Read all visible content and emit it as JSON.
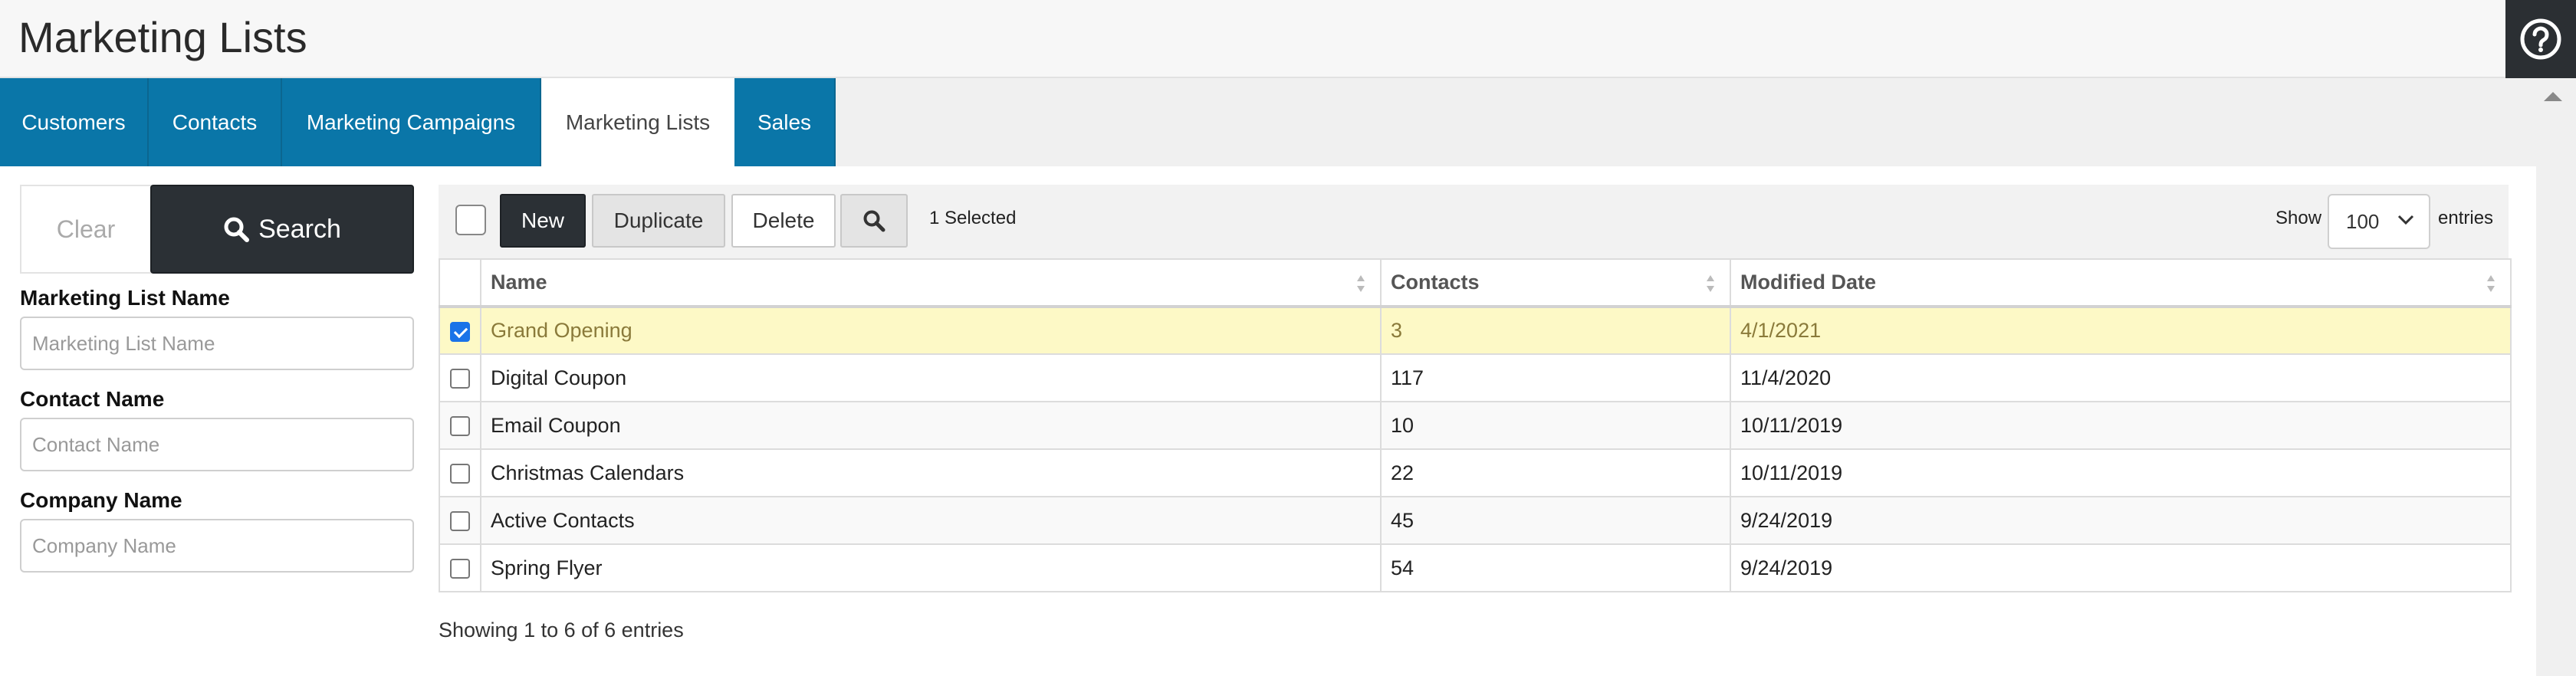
{
  "header": {
    "title": "Marketing Lists",
    "help_icon": "question-circle-icon"
  },
  "tabs": [
    {
      "label": "Customers",
      "active": false
    },
    {
      "label": "Contacts",
      "active": false
    },
    {
      "label": "Marketing Campaigns",
      "active": false
    },
    {
      "label": "Marketing Lists",
      "active": true
    },
    {
      "label": "Sales",
      "active": false
    }
  ],
  "filters": {
    "clear_label": "Clear",
    "search_label": "Search",
    "fields": [
      {
        "label": "Marketing List Name",
        "placeholder": "Marketing List Name",
        "value": ""
      },
      {
        "label": "Contact Name",
        "placeholder": "Contact Name",
        "value": ""
      },
      {
        "label": "Company Name",
        "placeholder": "Company Name",
        "value": ""
      }
    ]
  },
  "toolbar": {
    "new_label": "New",
    "duplicate_label": "Duplicate",
    "delete_label": "Delete",
    "selected_text": "1 Selected",
    "show_label": "Show",
    "entries_value": "100",
    "entries_label": "entries"
  },
  "table": {
    "columns": [
      "Name",
      "Contacts",
      "Modified Date"
    ],
    "rows": [
      {
        "name": "Grand Opening",
        "contacts": "3",
        "modified": "4/1/2021",
        "selected": true
      },
      {
        "name": "Digital Coupon",
        "contacts": "117",
        "modified": "11/4/2020",
        "selected": false
      },
      {
        "name": "Email Coupon",
        "contacts": "10",
        "modified": "10/11/2019",
        "selected": false
      },
      {
        "name": "Christmas Calendars",
        "contacts": "22",
        "modified": "10/11/2019",
        "selected": false
      },
      {
        "name": "Active Contacts",
        "contacts": "45",
        "modified": "9/24/2019",
        "selected": false
      },
      {
        "name": "Spring Flyer",
        "contacts": "54",
        "modified": "9/24/2019",
        "selected": false
      }
    ]
  },
  "footer": {
    "info": "Showing 1 to 6 of 6 entries"
  },
  "colors": {
    "tab_blue": "#0a76a8",
    "dark_button": "#2b3035",
    "selected_row": "#fdf9c6",
    "check_blue": "#1a73e8"
  }
}
